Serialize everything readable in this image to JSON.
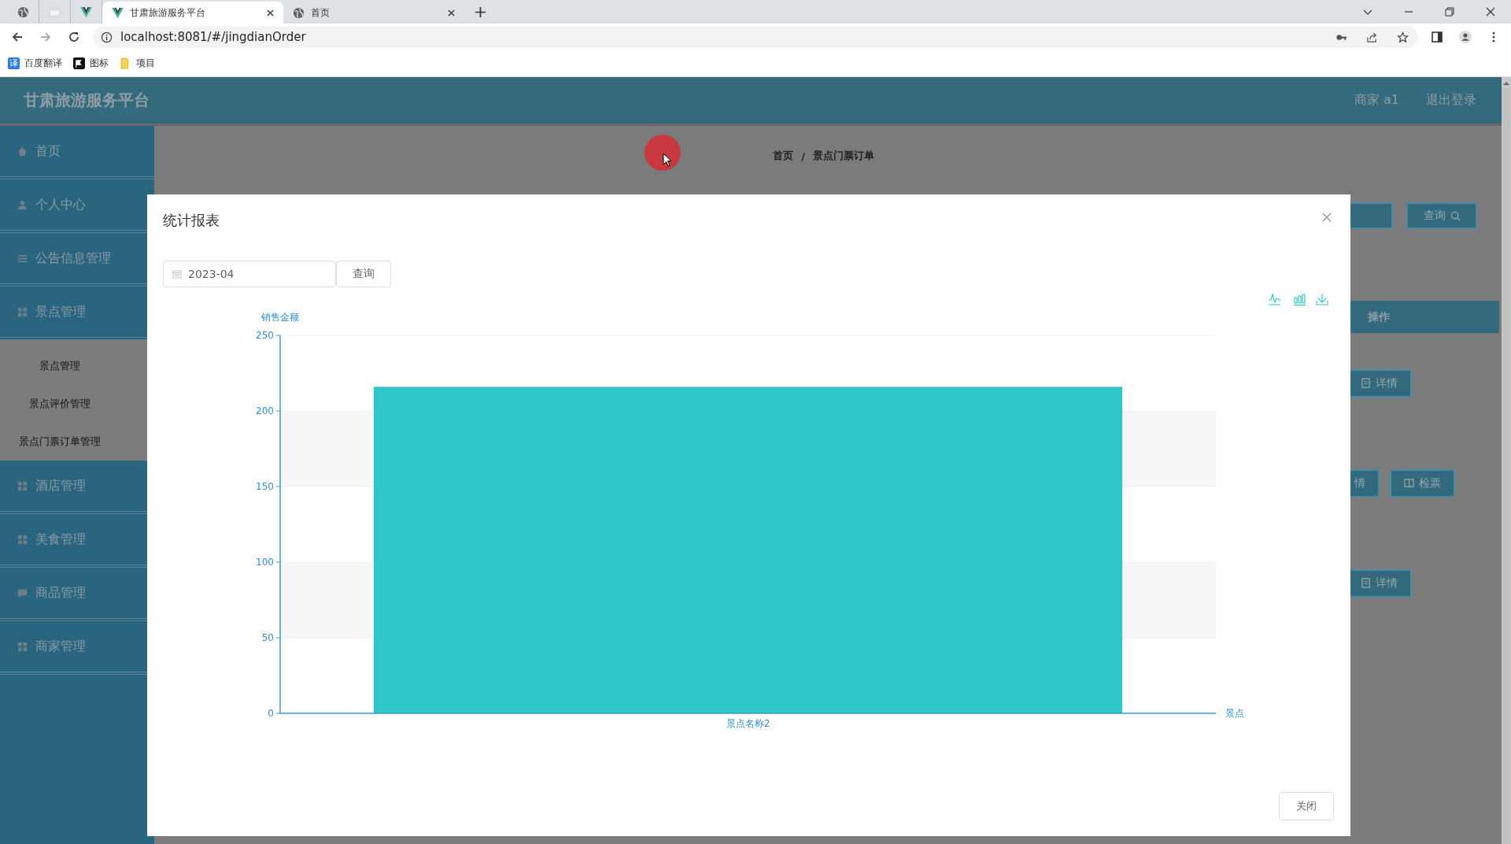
{
  "browser": {
    "pinned_tabs": [
      {
        "kind": "globe"
      },
      {
        "kind": "blank"
      },
      {
        "kind": "vue"
      }
    ],
    "tabs": [
      {
        "title": "甘肃旅游服务平台",
        "kind": "vue",
        "selected": true
      },
      {
        "title": "首页",
        "kind": "globe",
        "selected": false
      }
    ],
    "url": "localhost:8081/#/jingdianOrder",
    "bookmarks": [
      {
        "label": "百度翻译",
        "kind": "translate",
        "badge": "译"
      },
      {
        "label": "图标",
        "kind": "flag"
      },
      {
        "label": "项目",
        "kind": "folder"
      }
    ]
  },
  "header": {
    "title": "甘肃旅游服务平台",
    "user": "商家 a1",
    "logout": "退出登录"
  },
  "sidebar": {
    "items": [
      {
        "label": "首页",
        "kind": "home"
      },
      {
        "label": "个人中心",
        "kind": "user"
      },
      {
        "label": "公告信息管理",
        "kind": "list"
      },
      {
        "label": "景点管理",
        "kind": "grid",
        "expanded": true,
        "children": [
          {
            "label": "景点管理"
          },
          {
            "label": "景点评价管理"
          },
          {
            "label": "景点门票订单管理"
          }
        ]
      },
      {
        "label": "酒店管理",
        "kind": "grid"
      },
      {
        "label": "美食管理",
        "kind": "grid"
      },
      {
        "label": "商品管理",
        "kind": "comment"
      },
      {
        "label": "商家管理",
        "kind": "grid"
      }
    ]
  },
  "page": {
    "breadcrumb": [
      "首页",
      "景点门票订单"
    ],
    "breadcrumb_separator": "/",
    "search_button": "查询",
    "table": {
      "columns": [
        "操作"
      ],
      "rows": [
        {
          "actions": [
            {
              "label": "详情",
              "kind": "detail"
            }
          ]
        },
        {
          "actions": [
            {
              "label": "情",
              "kind": "partial"
            },
            {
              "label": "检票",
              "kind": "ticket"
            }
          ]
        },
        {
          "actions": [
            {
              "label": "详情",
              "kind": "detail"
            }
          ]
        }
      ]
    }
  },
  "dialog": {
    "title": "统计报表",
    "month": "2023-04",
    "query_button": "查询",
    "close_button": "关闭",
    "chart_data": {
      "type": "bar",
      "xlabel": "景点",
      "ylabel": "销售金额",
      "categories": [
        "景点名称2"
      ],
      "values": [
        216
      ],
      "ylim": [
        0,
        250
      ],
      "grid": true,
      "yticks": [
        0,
        50,
        100,
        150,
        200,
        250
      ]
    }
  }
}
